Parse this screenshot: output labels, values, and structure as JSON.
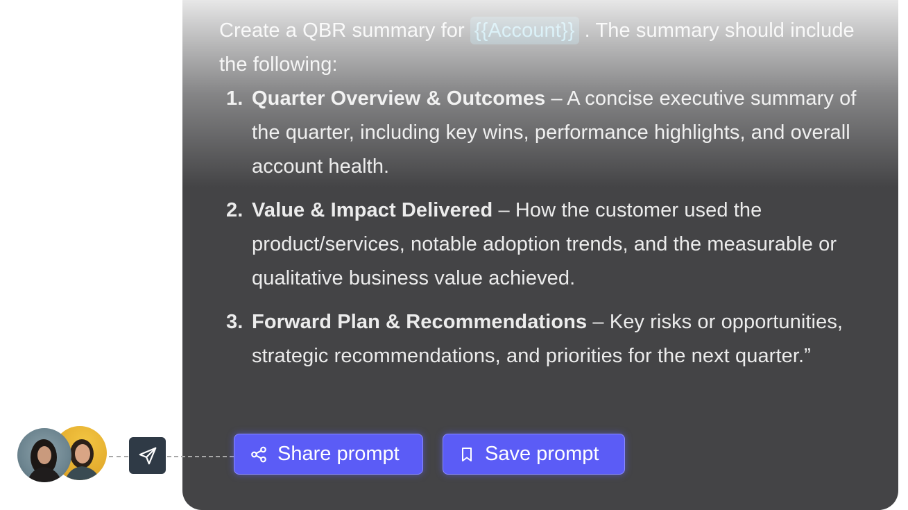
{
  "prompt": {
    "intro_before": "Create a QBR summary for ",
    "variable": "{{Account}}",
    "intro_after": " . The summary should include the following:",
    "items": [
      {
        "number": "1.",
        "title": "Quarter Overview & Outcomes",
        "text": " – A concise executive summary of the quarter, including key wins, performance highlights, and overall account health."
      },
      {
        "number": "2.",
        "title": "Value & Impact Delivered",
        "text": " – How the customer used the product/services, notable adoption trends, and the measurable or qualitative business value achieved."
      },
      {
        "number": "3.",
        "title": "Forward Plan & Recommendations",
        "text": " – Key risks or opportunities, strategic recommendations, and priorities for the next quarter.”"
      }
    ]
  },
  "actions": {
    "share_label": "Share prompt",
    "save_label": "Save prompt",
    "share_icon": "share-icon",
    "save_icon": "bookmark-icon",
    "send_icon": "paper-plane-icon"
  },
  "colors": {
    "card_bg": "#444446",
    "button_bg": "#5b5cf6",
    "variable_chip": "#8fd4ea",
    "send_bg": "#2f3a46"
  }
}
